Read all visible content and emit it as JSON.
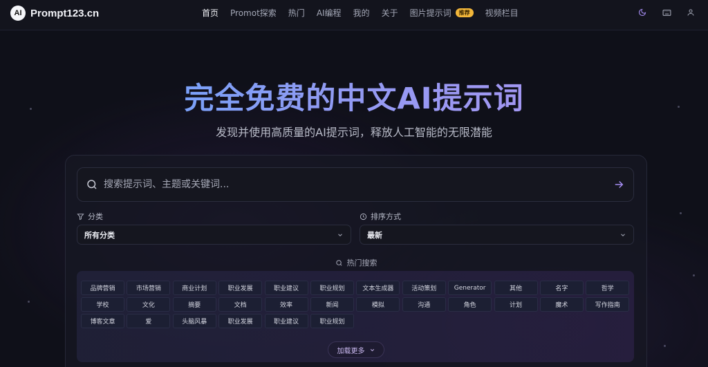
{
  "header": {
    "logo_badge": "AI",
    "logo_text": "Prompt123.cn",
    "nav": [
      {
        "label": "首页",
        "active": true
      },
      {
        "label": "Promot探索"
      },
      {
        "label": "热门"
      },
      {
        "label": "AI编程"
      },
      {
        "label": "我的"
      },
      {
        "label": "关于"
      },
      {
        "label": "图片提示词",
        "badge": "推荐"
      },
      {
        "label": "视频栏目"
      }
    ],
    "icons": [
      "moon-icon",
      "keyboard-icon",
      "user-icon"
    ]
  },
  "hero": {
    "title": "完全免费的中文AI提示词",
    "subtitle": "发现并使用高质量的AI提示词，释放人工智能的无限潜能"
  },
  "search": {
    "placeholder": "搜索提示词、主题或关键词..."
  },
  "filters": {
    "category_label": "分类",
    "category_value": "所有分类",
    "sort_label": "排序方式",
    "sort_value": "最新"
  },
  "hot": {
    "title": "热门搜索",
    "tags": [
      "品牌营销",
      "市场营销",
      "商业计划",
      "职业发展",
      "职业建议",
      "职业规划",
      "文本生成器",
      "活动策划",
      "Generator",
      "其他",
      "名字",
      "哲学",
      "学校",
      "文化",
      "摘要",
      "文档",
      "效率",
      "新闻",
      "模拟",
      "沟通",
      "角色",
      "计划",
      "魔术",
      "写作指南",
      "博客文章",
      "爱",
      "头脑风暴",
      "职业发展",
      "职业建议",
      "职业规划"
    ],
    "load_more": "加载更多"
  },
  "colors": {
    "accent": "#9b7cf2",
    "background": "#0f1019",
    "badge": "#f3b73a"
  }
}
